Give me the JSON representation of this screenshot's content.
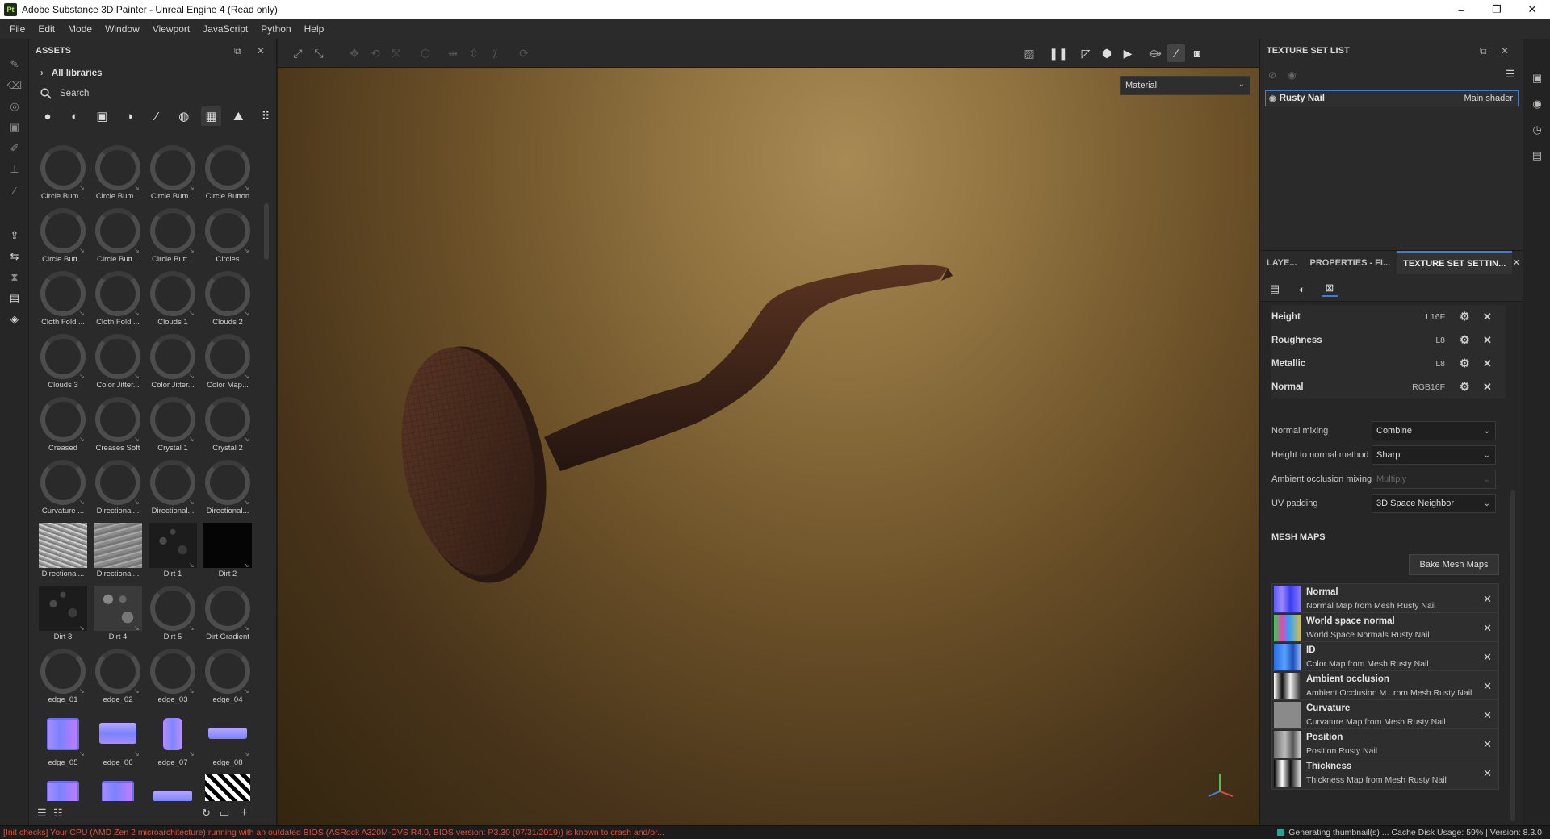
{
  "window": {
    "title": "Adobe Substance 3D Painter - Unreal Engine 4 (Read only)",
    "logo": "Pt",
    "min": "–",
    "max": "❐",
    "close": "✕"
  },
  "menu": [
    "File",
    "Edit",
    "Mode",
    "Window",
    "Viewport",
    "JavaScript",
    "Python",
    "Help"
  ],
  "assets": {
    "title": "ASSETS",
    "all_libraries": "All libraries",
    "search_placeholder": "Search",
    "items": [
      {
        "label": "Circle Bum...",
        "kind": "ring"
      },
      {
        "label": "Circle Bum...",
        "kind": "ring"
      },
      {
        "label": "Circle Bum...",
        "kind": "ring"
      },
      {
        "label": "Circle Button",
        "kind": "ring"
      },
      {
        "label": "Circle Butt...",
        "kind": "ring"
      },
      {
        "label": "Circle Butt...",
        "kind": "ring"
      },
      {
        "label": "Circle Butt...",
        "kind": "ring"
      },
      {
        "label": "Circles",
        "kind": "ring"
      },
      {
        "label": "Cloth Fold ...",
        "kind": "ring"
      },
      {
        "label": "Cloth Fold ...",
        "kind": "ring"
      },
      {
        "label": "Clouds 1",
        "kind": "ring"
      },
      {
        "label": "Clouds 2",
        "kind": "ring"
      },
      {
        "label": "Clouds 3",
        "kind": "ring"
      },
      {
        "label": "Color Jitter...",
        "kind": "ring"
      },
      {
        "label": "Color Jitter...",
        "kind": "ring"
      },
      {
        "label": "Color Map...",
        "kind": "ring"
      },
      {
        "label": "Creased",
        "kind": "ring"
      },
      {
        "label": "Creases Soft",
        "kind": "ring"
      },
      {
        "label": "Crystal 1",
        "kind": "ring"
      },
      {
        "label": "Crystal 2",
        "kind": "ring"
      },
      {
        "label": "Curvature ...",
        "kind": "ring"
      },
      {
        "label": "Directional...",
        "kind": "ring"
      },
      {
        "label": "Directional...",
        "kind": "ring"
      },
      {
        "label": "Directional...",
        "kind": "ring"
      },
      {
        "label": "Directional...",
        "kind": "noise-light"
      },
      {
        "label": "Directional...",
        "kind": "noise-grey"
      },
      {
        "label": "Dirt 1",
        "kind": "noise-dark"
      },
      {
        "label": "Dirt 2",
        "kind": "black"
      },
      {
        "label": "Dirt 3",
        "kind": "noise-dark"
      },
      {
        "label": "Dirt 4",
        "kind": "noise-mid"
      },
      {
        "label": "Dirt 5",
        "kind": "ring"
      },
      {
        "label": "Dirt Gradient",
        "kind": "ring"
      },
      {
        "label": "edge_01",
        "kind": "ring"
      },
      {
        "label": "edge_02",
        "kind": "ring"
      },
      {
        "label": "edge_03",
        "kind": "ring"
      },
      {
        "label": "edge_04",
        "kind": "ring"
      },
      {
        "label": "edge_05",
        "kind": "normal-square"
      },
      {
        "label": "edge_06",
        "kind": "normal-wide"
      },
      {
        "label": "edge_07",
        "kind": "normal-tall"
      },
      {
        "label": "edge_08",
        "kind": "normal-bar"
      },
      {
        "label": "",
        "kind": "normal-square"
      },
      {
        "label": "",
        "kind": "normal-square"
      },
      {
        "label": "",
        "kind": "normal-bar"
      },
      {
        "label": "",
        "kind": "zigzag"
      }
    ]
  },
  "viewport": {
    "material_mode": "Material"
  },
  "texture_set_list": {
    "title": "TEXTURE SET LIST",
    "set_name": "Rusty Nail",
    "shader": "Main shader"
  },
  "tabs": [
    "LAYE...",
    "PROPERTIES - FI...",
    "TEXTURE SET SETTIN..."
  ],
  "channels": [
    {
      "name": "Height",
      "format": "L16F"
    },
    {
      "name": "Roughness",
      "format": "L8"
    },
    {
      "name": "Metallic",
      "format": "L8"
    },
    {
      "name": "Normal",
      "format": "RGB16F"
    }
  ],
  "properties": [
    {
      "label": "Normal mixing",
      "value": "Combine",
      "disabled": false
    },
    {
      "label": "Height to normal method",
      "value": "Sharp",
      "disabled": false
    },
    {
      "label": "Ambient occlusion mixing",
      "value": "Multiply",
      "disabled": true
    },
    {
      "label": "UV padding",
      "value": "3D Space Neighbor",
      "disabled": false
    }
  ],
  "mesh_maps": {
    "title": "MESH MAPS",
    "bake_label": "Bake Mesh Maps",
    "items": [
      {
        "title": "Normal",
        "sub": "Normal Map from Mesh Rusty Nail",
        "icon": "normal"
      },
      {
        "title": "World space normal",
        "sub": "World Space Normals Rusty Nail",
        "icon": "world"
      },
      {
        "title": "ID",
        "sub": "Color Map from Mesh Rusty Nail",
        "icon": "id"
      },
      {
        "title": "Ambient occlusion",
        "sub": "Ambient Occlusion M...rom Mesh Rusty Nail",
        "icon": "ao"
      },
      {
        "title": "Curvature",
        "sub": "Curvature Map from Mesh Rusty Nail",
        "icon": "curv"
      },
      {
        "title": "Position",
        "sub": "Position Rusty Nail",
        "icon": "pos"
      },
      {
        "title": "Thickness",
        "sub": "Thickness Map from Mesh Rusty Nail",
        "icon": "thick"
      }
    ]
  },
  "status": {
    "warning": "[Init checks] Your CPU (AMD Zen 2 microarchitecture) running with an outdated BIOS (ASRock A320M-DVS R4.0, BIOS version: P3.30 (07/31/2019)) is known to crash and/or...",
    "right": "Generating thumbnail(s) ...     Cache Disk Usage:  59% | Version: 8.3.0"
  }
}
